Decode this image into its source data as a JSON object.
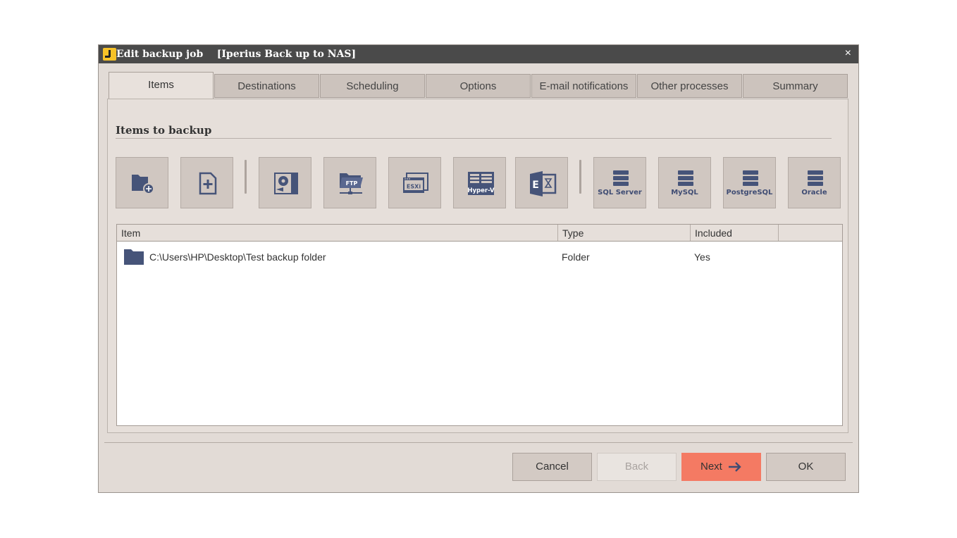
{
  "window": {
    "title": "Edit backup job    [Iperius Back up to NAS]",
    "close_glyph": "×"
  },
  "tabs": [
    {
      "label": "Items",
      "active": true
    },
    {
      "label": "Destinations",
      "active": false
    },
    {
      "label": "Scheduling",
      "active": false
    },
    {
      "label": "Options",
      "active": false
    },
    {
      "label": "E-mail notifications",
      "active": false
    },
    {
      "label": "Other processes",
      "active": false
    },
    {
      "label": "Summary",
      "active": false
    }
  ],
  "section": {
    "title": "Items to backup"
  },
  "toolbar": {
    "add_folder_icon": "folder-plus-icon",
    "add_file_icon": "file-plus-icon",
    "drive_image_icon": "disk-image-icon",
    "ftp_icon": "ftp-folder-icon",
    "esxi_label": "ESXi",
    "hyperv_label": "Hyper-V",
    "exchange_label": "E",
    "sql_server_label": "SQL Server",
    "mysql_label": "MySQL",
    "postgresql_label": "PostgreSQL",
    "oracle_label": "Oracle",
    "ftp_label": "FTP"
  },
  "grid": {
    "columns": [
      "Item",
      "Type",
      "Included"
    ],
    "rows": [
      {
        "item": "C:\\Users\\HP\\Desktop\\Test backup folder",
        "type": "Folder",
        "included": "Yes",
        "icon": "folder-icon"
      }
    ]
  },
  "footer": {
    "cancel": "Cancel",
    "back": "Back",
    "next": "Next",
    "ok": "OK"
  },
  "colors": {
    "accent": "#f47a63",
    "icon": "#465479",
    "titlebar": "#4a4a4a",
    "app_icon": "#f7c228"
  }
}
